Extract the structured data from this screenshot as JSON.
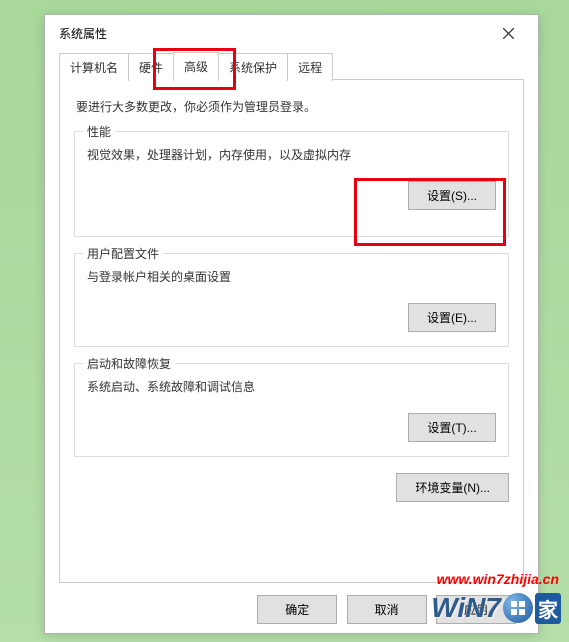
{
  "window": {
    "title": "系统属性"
  },
  "tabs": {
    "computer_name": "计算机名",
    "hardware": "硬件",
    "advanced": "高级",
    "system_protection": "系统保护",
    "remote": "远程"
  },
  "content": {
    "admin_note": "要进行大多数更改，你必须作为管理员登录。",
    "performance": {
      "title": "性能",
      "desc": "视觉效果，处理器计划，内存使用，以及虚拟内存",
      "button": "设置(S)..."
    },
    "user_profile": {
      "title": "用户配置文件",
      "desc": "与登录帐户相关的桌面设置",
      "button": "设置(E)..."
    },
    "startup": {
      "title": "启动和故障恢复",
      "desc": "系统启动、系统故障和调试信息",
      "button": "设置(T)..."
    },
    "env_button": "环境变量(N)..."
  },
  "buttons": {
    "ok": "确定",
    "cancel": "取消",
    "apply": "应用"
  },
  "watermark": "www.win7zhijia.cn",
  "logo": {
    "text": "WiN7",
    "suffix": "家"
  }
}
